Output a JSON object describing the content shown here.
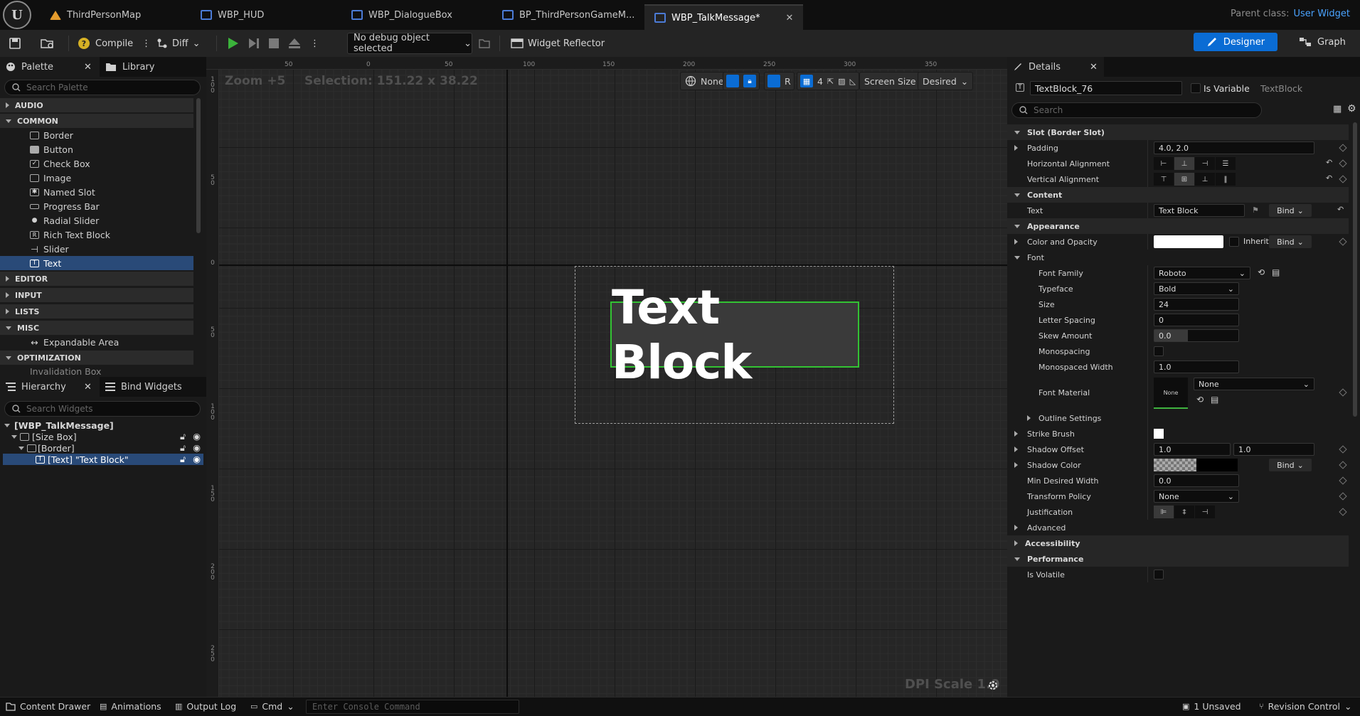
{
  "app": {
    "parent_class_label": "Parent class:",
    "parent_class_value": "User Widget"
  },
  "tabs": [
    {
      "label": "ThirdPersonMap",
      "icon": "level-map-icon"
    },
    {
      "label": "WBP_HUD",
      "icon": "widget-blueprint-icon"
    },
    {
      "label": "WBP_DialogueBox",
      "icon": "widget-blueprint-icon"
    },
    {
      "label": "BP_ThirdPersonGameM...",
      "icon": "blueprint-icon"
    },
    {
      "label": "WBP_TalkMessage*",
      "icon": "widget-blueprint-icon",
      "active": true
    }
  ],
  "toolbar": {
    "compile_label": "Compile",
    "diff_label": "Diff",
    "debug_object": "No debug object selected",
    "widget_reflector": "Widget Reflector",
    "designer_label": "Designer",
    "graph_label": "Graph"
  },
  "palette": {
    "tab_label": "Palette",
    "library_label": "Library",
    "search_placeholder": "Search Palette",
    "categories": {
      "audio": "AUDIO",
      "common": "COMMON",
      "editor": "EDITOR",
      "input": "INPUT",
      "lists": "LISTS",
      "misc": "MISC",
      "optimization": "OPTIMIZATION"
    },
    "common_items": [
      "Border",
      "Button",
      "Check Box",
      "Image",
      "Named Slot",
      "Progress Bar",
      "Radial Slider",
      "Rich Text Block",
      "Slider",
      "Text"
    ],
    "misc_items": [
      "Expandable Area"
    ],
    "optimization_partial": "Invalidation Box"
  },
  "hierarchy": {
    "tab_label": "Hierarchy",
    "bind_label": "Bind Widgets",
    "search_placeholder": "Search Widgets",
    "rows": [
      "[WBP_TalkMessage]",
      "[Size Box]",
      "[Border]",
      "[Text] \"Text Block\""
    ]
  },
  "canvas": {
    "zoom": "Zoom +5",
    "selection": "Selection: 151.22 x 38.22",
    "dpi": "DPI Scale 1.0",
    "tb_none": "None",
    "tb_r": "R",
    "tb_grid": "4",
    "tb_screen_size": "Screen Size",
    "tb_desired": "Desired",
    "ruler_top": [
      "50",
      "0",
      "50",
      "100",
      "150",
      "200",
      "250",
      "300",
      "350"
    ],
    "ruler_left": [
      "1 0 0",
      "5 0",
      "0",
      "5 0",
      "1 0 0",
      "1 5 0",
      "2 0 0",
      "2 5 0"
    ],
    "text_block": "Text Block"
  },
  "details": {
    "tab_label": "Details",
    "widget_name": "TextBlock_76",
    "is_variable": "Is Variable",
    "class_name": "TextBlock",
    "search_placeholder": "Search",
    "sec_slot": "Slot (Border Slot)",
    "padding_label": "Padding",
    "padding_value": "4.0, 2.0",
    "halign_label": "Horizontal Alignment",
    "valign_label": "Vertical Alignment",
    "sec_content": "Content",
    "text_label": "Text",
    "text_value": "Text Block",
    "bind": "Bind",
    "sec_appearance": "Appearance",
    "color_opacity_label": "Color and Opacity",
    "inherit_label": "Inherit",
    "font_label": "Font",
    "font_family_label": "Font Family",
    "font_family_value": "Roboto",
    "typeface_label": "Typeface",
    "typeface_value": "Bold",
    "size_label": "Size",
    "size_value": "24",
    "letter_spacing_label": "Letter Spacing",
    "letter_spacing_value": "0",
    "skew_label": "Skew Amount",
    "skew_value": "0.0",
    "monospacing_label": "Monospacing",
    "monospaced_width_label": "Monospaced Width",
    "monospaced_width_value": "1.0",
    "font_material_label": "Font Material",
    "font_material_thumb": "None",
    "font_material_value": "None",
    "outline_label": "Outline Settings",
    "strike_label": "Strike Brush",
    "shadow_offset_label": "Shadow Offset",
    "shadow_offset_x": "1.0",
    "shadow_offset_y": "1.0",
    "shadow_color_label": "Shadow Color",
    "min_width_label": "Min Desired Width",
    "min_width_value": "0.0",
    "transform_label": "Transform Policy",
    "transform_value": "None",
    "justification_label": "Justification",
    "sec_advanced": "Advanced",
    "sec_accessibility": "Accessibility",
    "sec_performance": "Performance",
    "volatile_label": "Is Volatile"
  },
  "statusbar": {
    "content_drawer": "Content Drawer",
    "animations": "Animations",
    "output_log": "Output Log",
    "cmd": "Cmd",
    "console_placeholder": "Enter Console Command",
    "unsaved": "1 Unsaved",
    "revision": "Revision Control"
  },
  "colors": {
    "accent": "#0a6cd4",
    "selection": "#294a78",
    "widget_outline": "#33c233",
    "link": "#4aa3ff"
  }
}
